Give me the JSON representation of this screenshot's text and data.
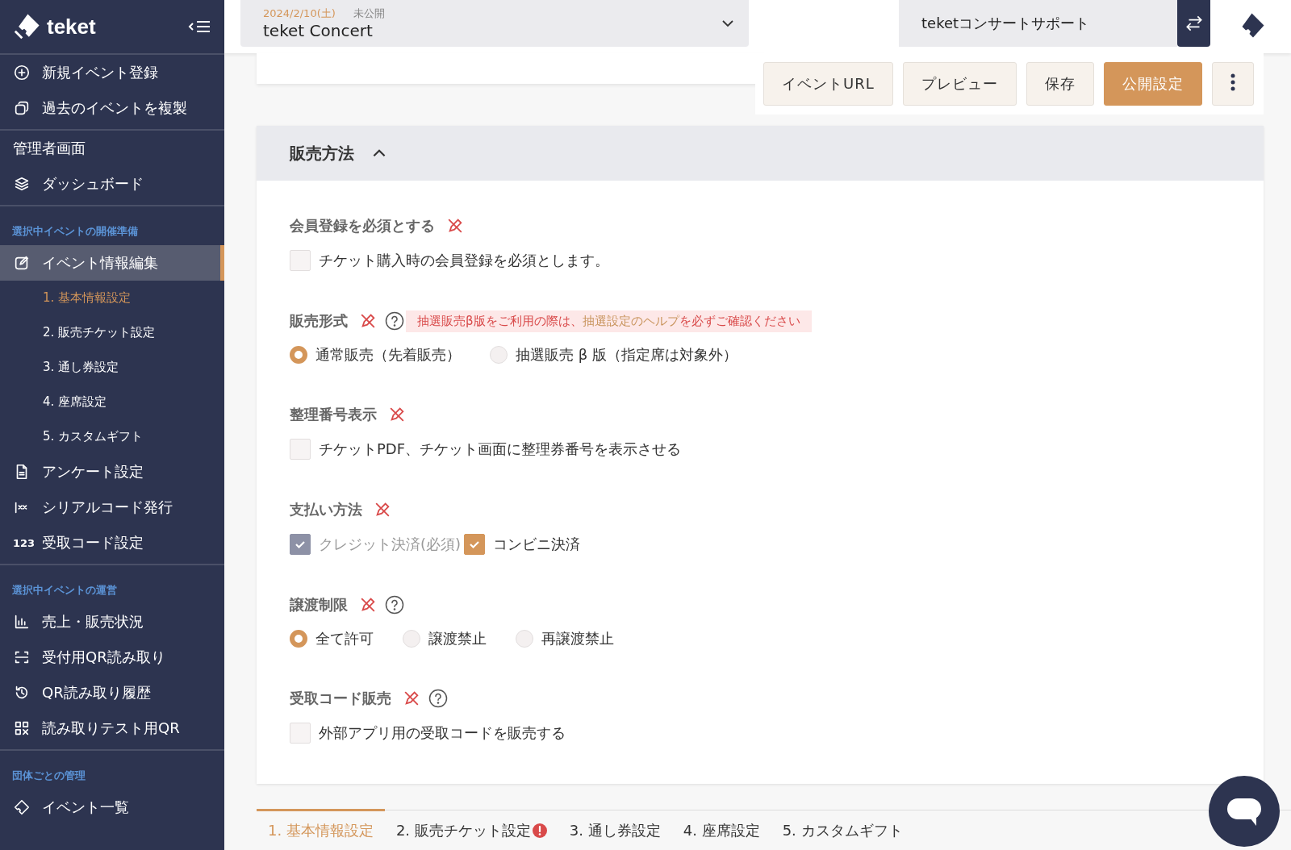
{
  "sidebar": {
    "logo": "teket",
    "groups": [
      {
        "items": [
          {
            "label": "新規イベント登録",
            "selected": false
          },
          {
            "label": "過去のイベントを複製",
            "selected": false
          }
        ]
      },
      {
        "items": [
          {
            "label": "管理者画面",
            "selected": false
          },
          {
            "label": "ダッシュボード",
            "selected": false
          }
        ]
      },
      {
        "heading": "選択中イベントの開催準備",
        "items": [
          {
            "label": "イベント情報編集",
            "selected": true,
            "children": [
              {
                "label": "1. 基本情報設定",
                "selected": true
              },
              {
                "label": "2. 販売チケット設定",
                "selected": false
              },
              {
                "label": "3. 通し券設定",
                "selected": false
              },
              {
                "label": "4. 座席設定",
                "selected": false
              },
              {
                "label": "5. カスタムギフト",
                "selected": false
              }
            ]
          },
          {
            "label": "アンケート設定",
            "selected": false
          },
          {
            "label": "シリアルコード発行",
            "selected": false
          },
          {
            "label": "受取コード設定",
            "selected": false,
            "icon_text": "123"
          }
        ]
      },
      {
        "heading": "選択中イベントの運営",
        "items": [
          {
            "label": "売上・販売状況",
            "selected": false
          },
          {
            "label": "受付用QR読み取り",
            "selected": false
          },
          {
            "label": "QR読み取り履歴",
            "selected": false
          },
          {
            "label": "読み取りテスト用QR",
            "selected": false
          }
        ]
      },
      {
        "heading": "団体ごとの管理",
        "items": [
          {
            "label": "イベント一覧",
            "selected": false
          }
        ]
      }
    ]
  },
  "header": {
    "event_date": "2024/2/10(土)",
    "event_status": "未公開",
    "event_name": "teket Concert",
    "organization": "teketコンサートサポート"
  },
  "toolbar": [
    {
      "label": "イベントURL",
      "kind": "default"
    },
    {
      "label": "プレビュー",
      "kind": "default"
    },
    {
      "label": "保存",
      "kind": "default"
    },
    {
      "label": "公開設定",
      "kind": "primary"
    },
    {
      "kind": "more"
    }
  ],
  "section": {
    "title": "販売方法",
    "expanded": true,
    "fields": [
      {
        "label": "会員登録を必須とする",
        "help": false,
        "kind": "checkbox",
        "options": [
          {
            "label": "チケット購入時の会員登録を必須とします。",
            "checked": false,
            "disabled": false
          }
        ]
      },
      {
        "label": "販売形式",
        "help": true,
        "notice": "抽選販売β版をご利用の際は、**抽選設定のヘルプ**を必ずご確認ください",
        "kind": "radio",
        "options": [
          {
            "label": "通常販売（先着販売）",
            "checked": true
          },
          {
            "label": "抽選販売 β 版（指定席は対象外）",
            "checked": false
          }
        ]
      },
      {
        "label": "整理番号表示",
        "help": false,
        "kind": "checkbox",
        "options": [
          {
            "label": "チケットPDF、チケット画面に整理券番号を表示させる",
            "checked": false,
            "disabled": false
          }
        ]
      },
      {
        "label": "支払い方法",
        "help": false,
        "kind": "checkbox",
        "options": [
          {
            "label": "クレジット決済(必須)",
            "checked": true,
            "disabled": true
          },
          {
            "label": "コンビニ決済",
            "checked": true,
            "disabled": false
          }
        ]
      },
      {
        "label": "譲渡制限",
        "help": true,
        "kind": "radio",
        "options": [
          {
            "label": "全て許可",
            "checked": true
          },
          {
            "label": "譲渡禁止",
            "checked": false
          },
          {
            "label": "再譲渡禁止",
            "checked": false
          }
        ]
      },
      {
        "label": "受取コード販売",
        "help": true,
        "kind": "checkbox",
        "options": [
          {
            "label": "外部アプリ用の受取コードを販売する",
            "checked": false,
            "disabled": false
          }
        ]
      }
    ]
  },
  "bottom_tabs": [
    {
      "label": "1. 基本情報設定",
      "selected": true,
      "alert": false
    },
    {
      "label": "2. 販売チケット設定",
      "selected": false,
      "alert": true
    },
    {
      "label": "3. 通し券設定",
      "selected": false,
      "alert": false
    },
    {
      "label": "4. 座席設定",
      "selected": false,
      "alert": false
    },
    {
      "label": "5. カスタムギフト",
      "selected": false,
      "alert": false
    }
  ]
}
